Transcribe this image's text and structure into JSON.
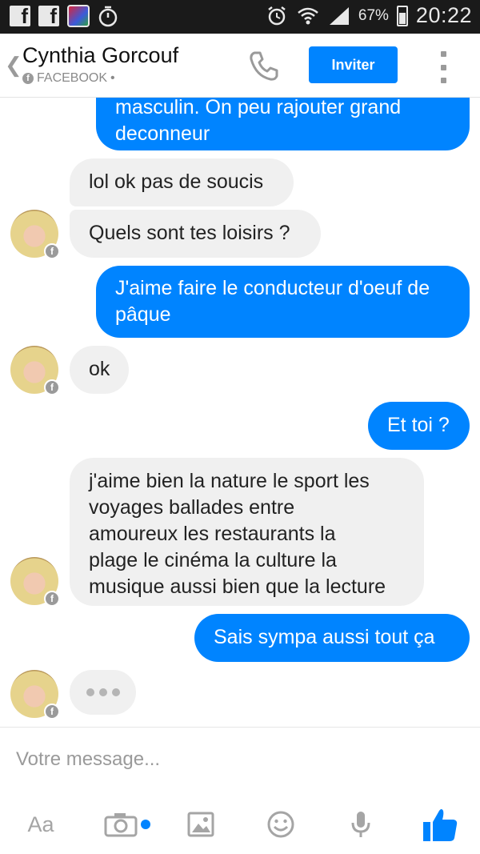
{
  "status_bar": {
    "battery": "67%",
    "time": "20:22"
  },
  "header": {
    "back_icon": "chevron-left-icon",
    "contact_name": "Cynthia Gorcouf",
    "source": "FACEBOOK",
    "source_suffix": "•",
    "invite_label": "Inviter"
  },
  "messages": [
    {
      "side": "out",
      "lines": [
        "masculin. On peu rajouter grand",
        "deconneur"
      ]
    },
    {
      "side": "in",
      "lines": [
        "lol ok pas de soucis"
      ]
    },
    {
      "side": "in",
      "lines": [
        "Quels sont tes loisirs ?"
      ]
    },
    {
      "side": "out",
      "lines": [
        "J'aime faire le conducteur d'oeuf de",
        "pâque"
      ]
    },
    {
      "side": "in",
      "lines": [
        "ok"
      ]
    },
    {
      "side": "out",
      "lines": [
        "Et toi ?"
      ]
    },
    {
      "side": "in",
      "lines": [
        "j'aime bien la nature le sport les",
        "voyages ballades entre",
        "amoureux les restaurants la",
        "plage le cinéma la culture la",
        "musique aussi bien que la lecture"
      ]
    },
    {
      "side": "out",
      "lines": [
        "Sais sympa aussi tout ça"
      ]
    }
  ],
  "composer": {
    "placeholder": "Votre message...",
    "text_format_label": "Aa"
  },
  "colors": {
    "accent": "#0084ff",
    "incoming_bubble": "#f0f0f0",
    "status_bar": "#1a1a1a"
  }
}
